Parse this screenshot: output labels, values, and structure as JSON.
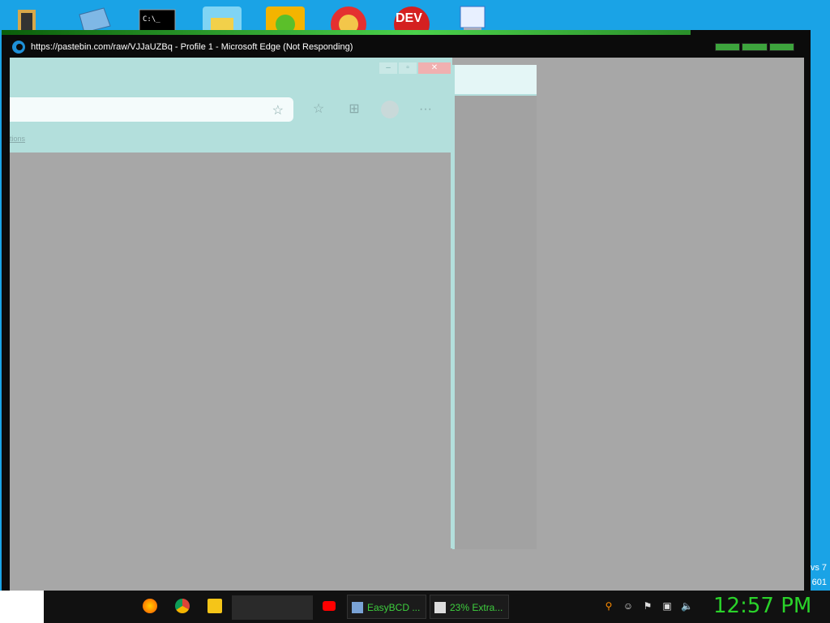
{
  "desktop": {
    "icons": [
      "file-manager-icon",
      "network-icon",
      "command-prompt-icon",
      "folder-icon",
      "angry-birds-icon",
      "paint-icon",
      "dev-cpp-icon",
      "easybcd-icon"
    ],
    "dev_label": "DEV",
    "side_text_1": "vs 7",
    "side_text_2": "601"
  },
  "window": {
    "title": "https://pastebin.com/raw/VJJaUZBq - Profile 1 - Microsoft Edge (Not Responding)"
  },
  "ghost_browser": {
    "fav_link": "tions"
  },
  "taskbar": {
    "tasks": [
      {
        "label": "EasyBCD ..."
      },
      {
        "label": "23% Extra..."
      }
    ],
    "clock": "12:57 PM"
  }
}
